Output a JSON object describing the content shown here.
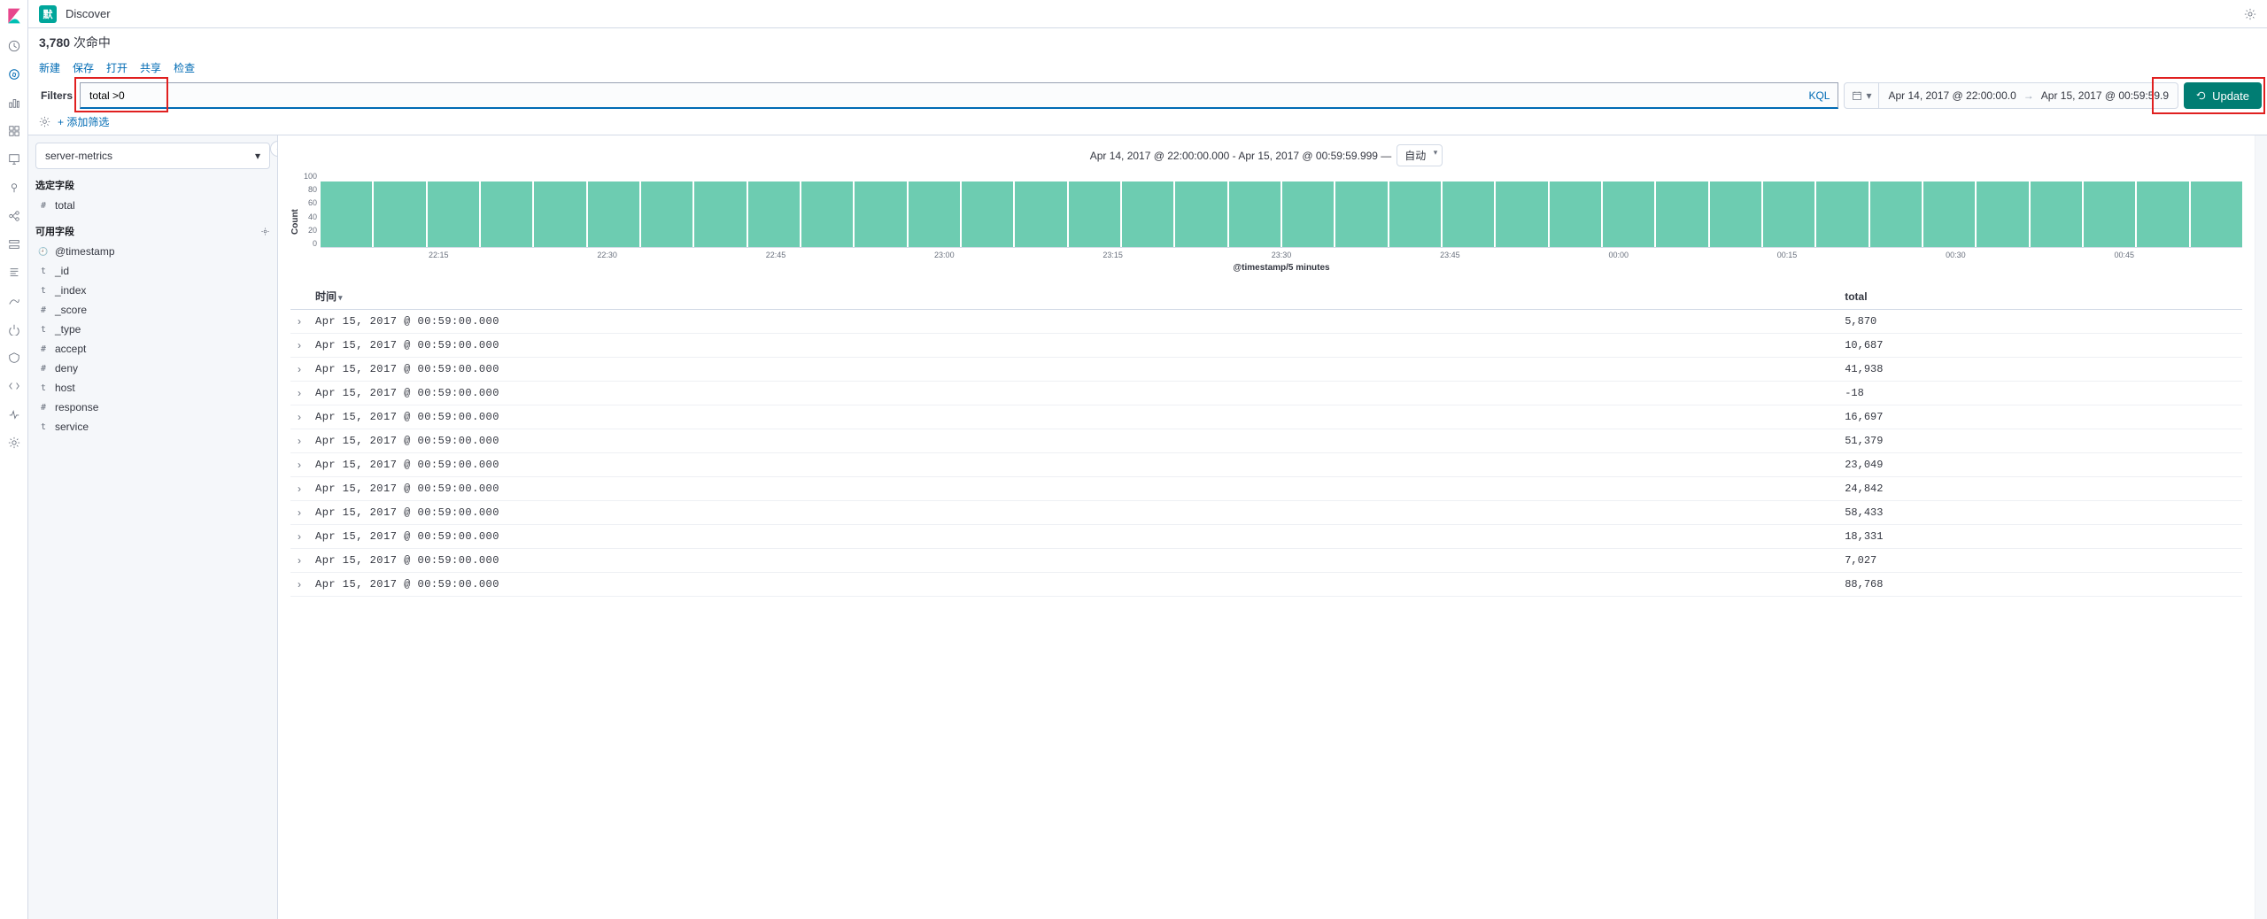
{
  "header": {
    "badge": "默",
    "title": "Discover"
  },
  "hits": {
    "count": "3,780",
    "label": "次命中"
  },
  "toolbar": {
    "new": "新建",
    "save": "保存",
    "open": "打开",
    "share": "共享",
    "inspect": "检查"
  },
  "filterbar": {
    "label": "Filters",
    "query": "total >0",
    "kql": "KQL",
    "date_from": "Apr 14, 2017 @ 22:00:00.0",
    "date_to": "Apr 15, 2017 @ 00:59:59.9",
    "update": "Update"
  },
  "add_filter": "+ 添加筛选",
  "sidebar": {
    "index_pattern": "server-metrics",
    "selected_label": "选定字段",
    "available_label": "可用字段",
    "selected_fields": [
      {
        "type": "#",
        "name": "total"
      }
    ],
    "available_fields": [
      {
        "type": "clock",
        "name": "@timestamp"
      },
      {
        "type": "t",
        "name": "_id"
      },
      {
        "type": "t",
        "name": "_index"
      },
      {
        "type": "#",
        "name": "_score"
      },
      {
        "type": "t",
        "name": "_type"
      },
      {
        "type": "#",
        "name": "accept"
      },
      {
        "type": "#",
        "name": "deny"
      },
      {
        "type": "t",
        "name": "host"
      },
      {
        "type": "#",
        "name": "response"
      },
      {
        "type": "t",
        "name": "service"
      }
    ]
  },
  "chart": {
    "header_range": "Apr 14, 2017 @ 22:00:00.000 - Apr 15, 2017 @ 00:59:59.999 —",
    "interval": "自动",
    "y_label": "Count",
    "x_label": "@timestamp/5 minutes"
  },
  "chart_data": {
    "type": "bar",
    "ylabel": "Count",
    "xlabel": "@timestamp/5 minutes",
    "ylim": [
      0,
      120
    ],
    "y_ticks": [
      100,
      80,
      60,
      40,
      20,
      0
    ],
    "x_ticks": [
      "22:15",
      "22:30",
      "22:45",
      "23:00",
      "23:15",
      "23:30",
      "23:45",
      "00:00",
      "00:15",
      "00:30",
      "00:45"
    ],
    "bar_count": 36,
    "values": [
      105,
      105,
      105,
      105,
      105,
      105,
      105,
      105,
      105,
      105,
      105,
      105,
      105,
      105,
      105,
      105,
      105,
      105,
      105,
      105,
      105,
      105,
      105,
      105,
      105,
      105,
      105,
      105,
      105,
      105,
      105,
      105,
      105,
      105,
      105,
      105
    ]
  },
  "docs": {
    "col_time": "时间",
    "col_total": "total",
    "rows": [
      {
        "time": "Apr 15, 2017 @ 00:59:00.000",
        "total": "5,870"
      },
      {
        "time": "Apr 15, 2017 @ 00:59:00.000",
        "total": "10,687"
      },
      {
        "time": "Apr 15, 2017 @ 00:59:00.000",
        "total": "41,938"
      },
      {
        "time": "Apr 15, 2017 @ 00:59:00.000",
        "total": "-18"
      },
      {
        "time": "Apr 15, 2017 @ 00:59:00.000",
        "total": "16,697"
      },
      {
        "time": "Apr 15, 2017 @ 00:59:00.000",
        "total": "51,379"
      },
      {
        "time": "Apr 15, 2017 @ 00:59:00.000",
        "total": "23,049"
      },
      {
        "time": "Apr 15, 2017 @ 00:59:00.000",
        "total": "24,842"
      },
      {
        "time": "Apr 15, 2017 @ 00:59:00.000",
        "total": "58,433"
      },
      {
        "time": "Apr 15, 2017 @ 00:59:00.000",
        "total": "18,331"
      },
      {
        "time": "Apr 15, 2017 @ 00:59:00.000",
        "total": "7,027"
      },
      {
        "time": "Apr 15, 2017 @ 00:59:00.000",
        "total": "88,768"
      }
    ]
  }
}
